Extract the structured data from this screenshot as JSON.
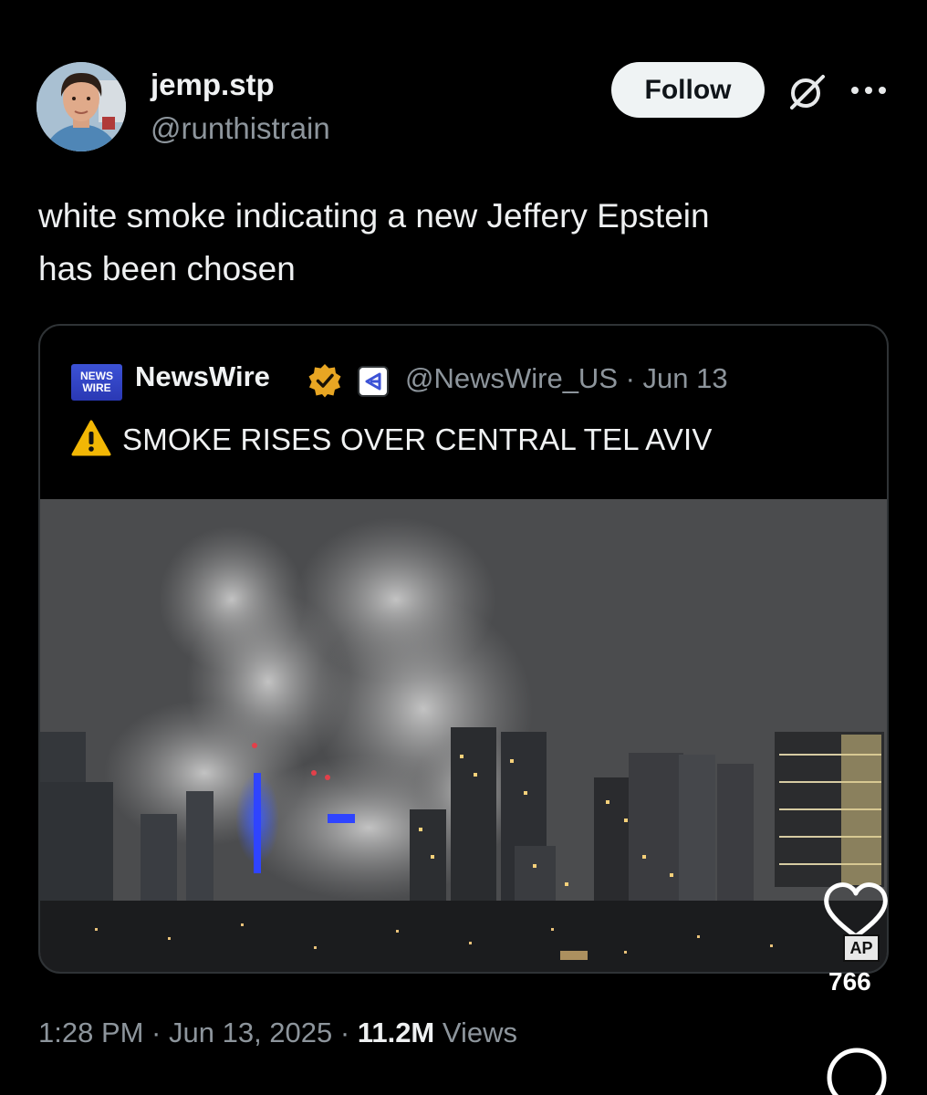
{
  "tweet": {
    "author": {
      "name": "jemp.stp",
      "handle": "@runthistrain"
    },
    "follow_label": "Follow",
    "text_line1": "white smoke indicating a new Jeffery Epstein",
    "text_line2": "has been chosen",
    "timestamp": "1:28 PM · Jun 13, 2025 · ",
    "views_count": "11.2M",
    "views_label": " Views"
  },
  "quote": {
    "logo_text_top": "NEWS",
    "logo_text_bottom": "WIRE",
    "name": "NewsWire",
    "meta": "@NewsWire_US · Jun 13",
    "headline": "SMOKE RISES OVER CENTRAL TEL AVIV"
  },
  "overlay": {
    "like_count": "766",
    "credit": "AP"
  },
  "icons": {
    "grok": "grok-icon",
    "more": "more-icon",
    "verified": "verified-badge-icon",
    "warning": "warning-icon",
    "heart": "heart-icon",
    "search": "search-icon"
  },
  "colors": {
    "background": "#000000",
    "follow_button": "#eff3f4",
    "verified_gold": "#e8a623",
    "newswire_blue": "#3c52d6"
  }
}
